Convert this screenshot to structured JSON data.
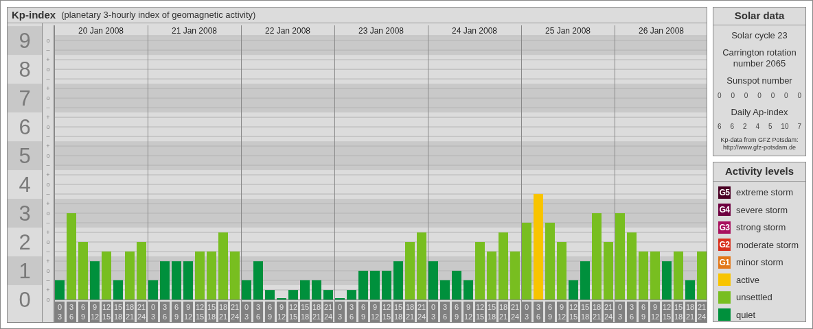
{
  "header": {
    "title": "Kp-index",
    "subtitle": "(planetary 3-hourly index of geomagnetic activity)"
  },
  "chart": {
    "days": [
      "20 Jan 2008",
      "21 Jan 2008",
      "22 Jan 2008",
      "23 Jan 2008",
      "24 Jan 2008",
      "25 Jan 2008",
      "26 Jan 2008"
    ],
    "minor_ticks": [
      "o",
      "–",
      "+",
      "o",
      "–",
      "+",
      "o",
      "–",
      "+",
      "o",
      "–",
      "+",
      "o",
      "–",
      "+",
      "o",
      "–",
      "+",
      "o",
      "–",
      "+",
      "o",
      "–",
      "+",
      "o",
      "–",
      "+",
      "o"
    ],
    "chart_data": {
      "type": "bar",
      "stacked": true,
      "grid": true,
      "ylim": [
        0,
        9.17
      ],
      "yticks": [
        9,
        8,
        7,
        6,
        5,
        4,
        3,
        2,
        1,
        0
      ],
      "categories": [
        "0 3",
        "3 6",
        "6 9",
        "9 12",
        "12 15",
        "15 18",
        "18 21",
        "21 24",
        "0 3",
        "3 6",
        "6 9",
        "9 12",
        "12 15",
        "15 18",
        "18 21",
        "21 24",
        "0 3",
        "3 6",
        "6 9",
        "9 12",
        "12 15",
        "15 18",
        "18 21",
        "21 24",
        "0 3",
        "3 6",
        "6 9",
        "9 12",
        "12 15",
        "15 18",
        "18 21",
        "21 24",
        "0 3",
        "3 6",
        "6 9",
        "9 12",
        "12 15",
        "15 18",
        "18 21",
        "21 24",
        "0 3",
        "3 6",
        "6 9",
        "9 12",
        "12 15",
        "15 18",
        "18 21",
        "21 24",
        "0 3",
        "3 6",
        "6 9",
        "9 12",
        "12 15",
        "15 18",
        "18 21",
        "21 24"
      ],
      "series": [
        {
          "color": "#00903c",
          "values": [
            0.67,
            null,
            null,
            1.33,
            null,
            0.67,
            null,
            null,
            0.67,
            1.33,
            1.33,
            1.33,
            null,
            null,
            null,
            null,
            0.67,
            1.33,
            0.33,
            0,
            0.33,
            0.67,
            0.67,
            0.33,
            0,
            0.33,
            1,
            1,
            1,
            1.33,
            null,
            null,
            1.33,
            0.67,
            1,
            0.67,
            null,
            null,
            null,
            null,
            null,
            null,
            null,
            null,
            0.67,
            1.33,
            null,
            null,
            null,
            null,
            null,
            null,
            1.33,
            null,
            0.67,
            null
          ]
        },
        {
          "color": "#78be20",
          "values": [
            null,
            3,
            2,
            null,
            1.67,
            null,
            1.67,
            2,
            null,
            null,
            null,
            null,
            1.67,
            1.67,
            2.33,
            1.67,
            null,
            null,
            null,
            null,
            null,
            null,
            null,
            null,
            null,
            null,
            null,
            null,
            null,
            null,
            2,
            2.33,
            null,
            null,
            null,
            null,
            2,
            1.67,
            2.33,
            1.67,
            2.67,
            null,
            2.67,
            2,
            null,
            null,
            3,
            2,
            3,
            2.33,
            1.67,
            1.67,
            null,
            1.67,
            null,
            1.67
          ]
        },
        {
          "color": "#f8c400",
          "values": [
            null,
            null,
            null,
            null,
            null,
            null,
            null,
            null,
            null,
            null,
            null,
            null,
            null,
            null,
            null,
            null,
            null,
            null,
            null,
            null,
            null,
            null,
            null,
            null,
            null,
            null,
            null,
            null,
            null,
            null,
            null,
            null,
            null,
            null,
            null,
            null,
            null,
            null,
            null,
            null,
            null,
            3.67,
            null,
            null,
            null,
            null,
            null,
            null,
            null,
            null,
            null,
            null,
            null,
            null,
            null,
            null
          ]
        }
      ]
    }
  },
  "solar_data": {
    "title": "Solar data",
    "solar_cycle": "Solar cycle 23",
    "carrington": [
      "Carrington rotation",
      "number 2065"
    ],
    "sunspot_label": "Sunspot number",
    "sunspot_values": [
      "0",
      "0",
      "0",
      "0",
      "0",
      "0",
      "0"
    ],
    "ap_label": "Daily Ap-index",
    "ap_values": [
      "6",
      "6",
      "2",
      "4",
      "5",
      "10",
      "7"
    ],
    "source": [
      "Kp-data from GFZ Potsdam:",
      "http://www.gfz-potsdam.de"
    ]
  },
  "activity_levels": {
    "title": "Activity levels",
    "items": [
      {
        "badge": "G5",
        "label": "extreme storm",
        "color": "#4a0024"
      },
      {
        "badge": "G4",
        "label": "severe storm",
        "color": "#6e0040"
      },
      {
        "badge": "G3",
        "label": "strong storm",
        "color": "#a8105e"
      },
      {
        "badge": "G2",
        "label": "moderate storm",
        "color": "#d8301e"
      },
      {
        "badge": "G1",
        "label": "minor storm",
        "color": "#e2781a"
      },
      {
        "label": "active",
        "color": "#f8c400"
      },
      {
        "label": "unsettled",
        "color": "#78be20"
      },
      {
        "label": "quiet",
        "color": "#00903c"
      }
    ]
  }
}
